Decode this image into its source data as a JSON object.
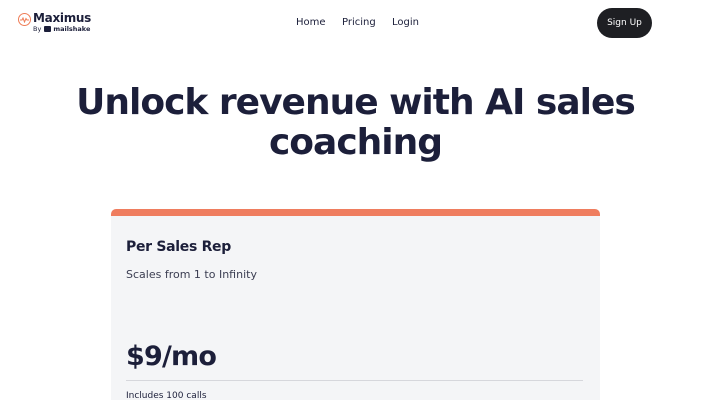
{
  "header": {
    "logo": {
      "name": "Maximus",
      "by": "By",
      "partner": "mailshake",
      "icon": "maximus-logo-icon",
      "accent_color": "#ef7d57"
    },
    "nav": [
      {
        "label": "Home"
      },
      {
        "label": "Pricing"
      },
      {
        "label": "Login"
      }
    ],
    "signup_label": "Sign Up"
  },
  "hero": {
    "title": "Unlock revenue with AI sales coaching"
  },
  "pricing_card": {
    "title": "Per Sales Rep",
    "subtitle": "Scales from 1 to Infinity",
    "price": "$9/mo",
    "features": [
      "Includes 100 calls"
    ],
    "accent_color": "#ef7d5f"
  },
  "colors": {
    "text": "#1c1f3a",
    "button_bg": "#1e1f23",
    "card_bg": "#f4f5f7"
  }
}
